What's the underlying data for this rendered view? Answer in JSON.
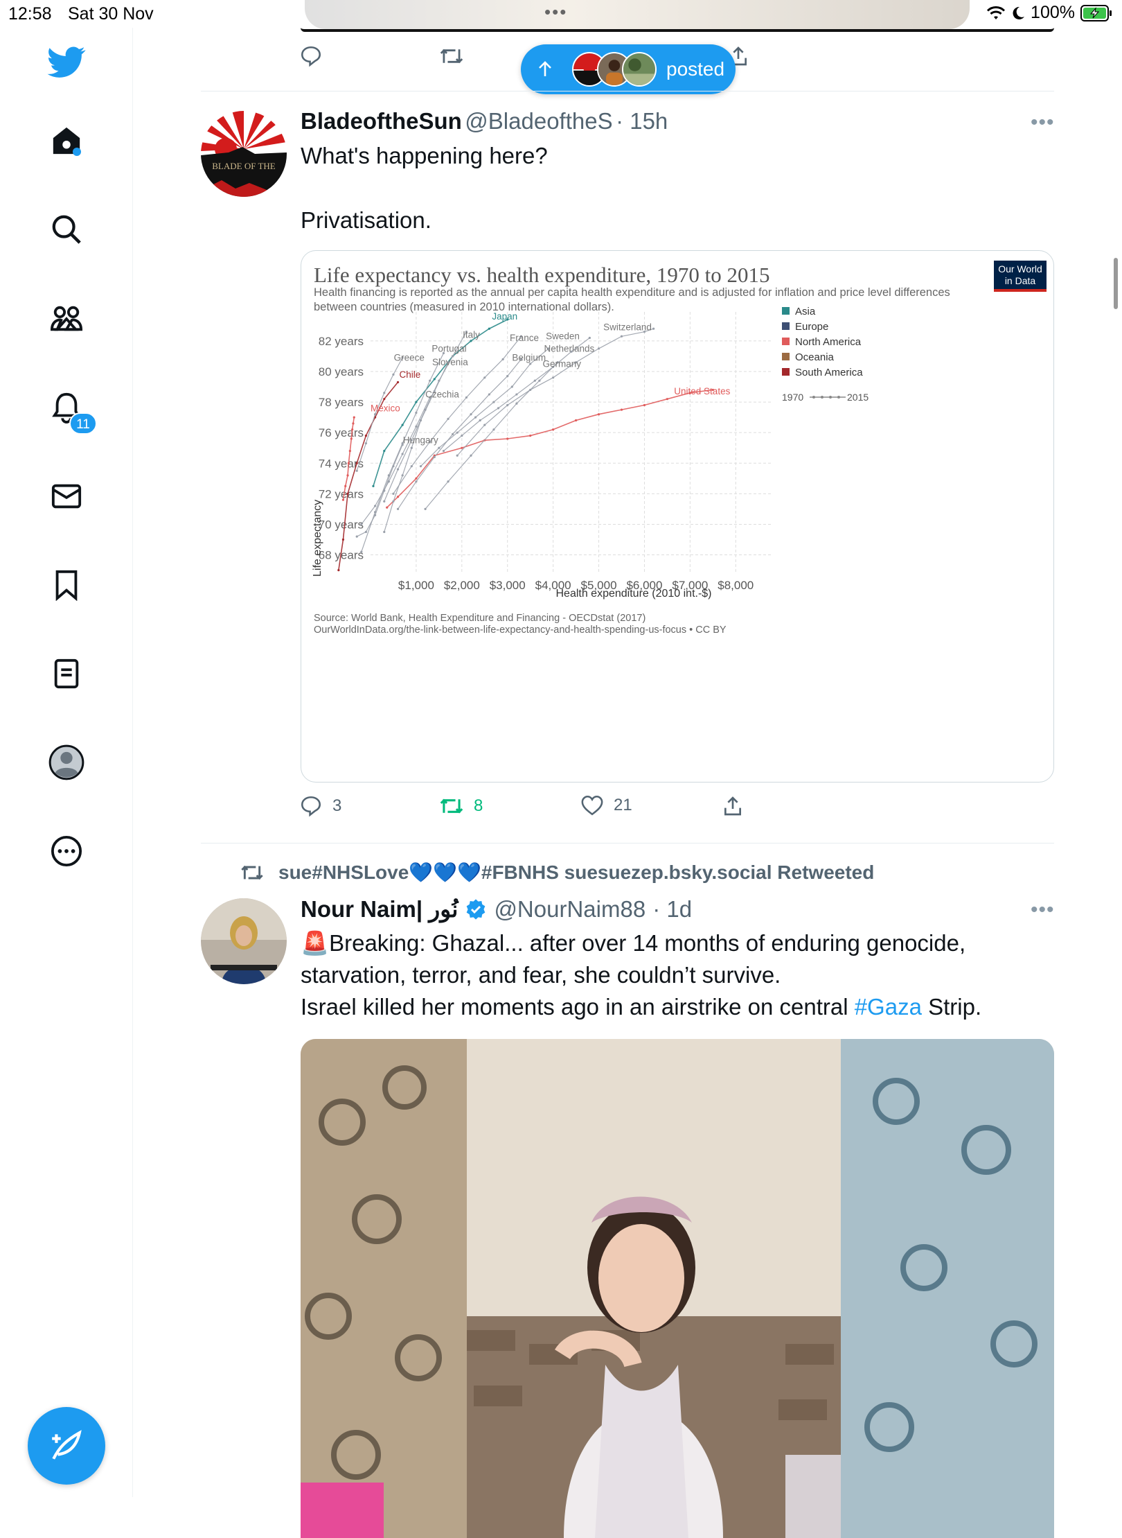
{
  "status": {
    "time": "12:58",
    "date": "Sat 30 Nov",
    "battery": "100%"
  },
  "sidebar": {
    "notification_count": "11"
  },
  "new_posts": {
    "label": "posted"
  },
  "tweet1": {
    "name": "BladeoftheSun",
    "handle": "@BladeoftheS",
    "time": "· 15h",
    "avatar_text": "BLADE OF THE",
    "text_line1": "What's happening here?",
    "text_line2": "Privatisation.",
    "replies": "3",
    "retweets": "8",
    "likes": "21"
  },
  "chart_data": {
    "type": "line",
    "title": "Life expectancy vs. health expenditure, 1970 to 2015",
    "subtitle": "Health financing is reported as the annual per capita health expenditure and is adjusted for inflation and price level differences between countries (measured in 2010 international dollars).",
    "logo": "Our World in Data",
    "xlabel": "Health expenditure (2010 int.-$)",
    "ylabel": "Life expectancy",
    "x_ticks": [
      "$1,000",
      "$2,000",
      "$3,000",
      "$4,000",
      "$5,000",
      "$6,000",
      "$7,000",
      "$8,000"
    ],
    "y_ticks": [
      "82 years",
      "80 years",
      "78 years",
      "76 years",
      "74 years",
      "72 years",
      "70 years",
      "68 years"
    ],
    "xlim": [
      0,
      8800
    ],
    "ylim": [
      66.8,
      83.9
    ],
    "legend": [
      {
        "name": "Asia",
        "color": "#2a8a8a"
      },
      {
        "name": "Europe",
        "color": "#3d4f73"
      },
      {
        "name": "North America",
        "color": "#e05b5b"
      },
      {
        "name": "Oceania",
        "color": "#9c6b42"
      },
      {
        "name": "South America",
        "color": "#a3282b"
      }
    ],
    "legend_range": {
      "start": "1970",
      "end": "2015"
    },
    "country_labels": [
      {
        "name": "Japan",
        "x": 2660,
        "y": 83.4,
        "color": "#2a8a8a"
      },
      {
        "name": "Italy",
        "x": 2020,
        "y": 82.2,
        "color": "#777"
      },
      {
        "name": "Switzerland",
        "x": 5100,
        "y": 82.7,
        "color": "#777"
      },
      {
        "name": "France",
        "x": 3050,
        "y": 82.0,
        "color": "#777"
      },
      {
        "name": "Sweden",
        "x": 3840,
        "y": 82.1,
        "color": "#777"
      },
      {
        "name": "Portugal",
        "x": 1340,
        "y": 81.3,
        "color": "#777"
      },
      {
        "name": "Netherlands",
        "x": 3800,
        "y": 81.3,
        "color": "#777"
      },
      {
        "name": "Greece",
        "x": 510,
        "y": 80.7,
        "color": "#777"
      },
      {
        "name": "Belgium",
        "x": 3100,
        "y": 80.7,
        "color": "#777"
      },
      {
        "name": "Slovenia",
        "x": 1350,
        "y": 80.4,
        "color": "#777"
      },
      {
        "name": "Germany",
        "x": 3770,
        "y": 80.3,
        "color": "#777"
      },
      {
        "name": "Chile",
        "x": 630,
        "y": 79.6,
        "color": "#a3282b"
      },
      {
        "name": "Czechia",
        "x": 1200,
        "y": 78.3,
        "color": "#777"
      },
      {
        "name": "United States",
        "x": 6650,
        "y": 78.5,
        "color": "#e05b5b"
      },
      {
        "name": "Mexico",
        "x": 0,
        "y": 77.4,
        "color": "#e05b5b"
      },
      {
        "name": "Hungary",
        "x": 710,
        "y": 75.3,
        "color": "#777"
      }
    ],
    "series": [
      {
        "name": "United States",
        "region": "North America",
        "x": [
          360,
          600,
          1000,
          1400,
          2000,
          2500,
          3000,
          3500,
          4000,
          4500,
          5000,
          5500,
          6000,
          6500,
          7000,
          7500
        ],
        "y": [
          71.1,
          71.8,
          73.0,
          74.5,
          75.0,
          75.5,
          75.6,
          75.8,
          76.2,
          76.8,
          77.2,
          77.5,
          77.8,
          78.2,
          78.6,
          78.8
        ]
      },
      {
        "name": "Mexico",
        "region": "North America",
        "x": [
          -600,
          -550,
          -500,
          -480,
          -450,
          -420,
          -400,
          -380,
          -360
        ],
        "y": [
          71.6,
          72.5,
          73.2,
          74.0,
          74.8,
          75.6,
          76.2,
          76.6,
          77.0
        ]
      },
      {
        "name": "Japan",
        "region": "Asia",
        "x": [
          60,
          300,
          700,
          1000,
          1400,
          1800,
          2200,
          2600,
          3000
        ],
        "y": [
          72.5,
          74.8,
          76.5,
          78.0,
          79.5,
          81.0,
          82.0,
          82.8,
          83.4
        ]
      },
      {
        "name": "Chile",
        "region": "South America",
        "x": [
          -700,
          -600,
          -500,
          -300,
          -100,
          100,
          300,
          600
        ],
        "y": [
          67.0,
          69.0,
          72.0,
          74.0,
          75.8,
          77.0,
          78.2,
          79.3
        ]
      },
      {
        "name": "Switzerland",
        "region": "Europe",
        "x": [
          1900,
          2500,
          3000,
          3500,
          4000,
          4500,
          5000,
          5500,
          6000,
          6200
        ],
        "y": [
          74.5,
          76.5,
          77.8,
          78.8,
          79.6,
          80.6,
          81.5,
          82.3,
          82.6,
          82.8
        ]
      },
      {
        "name": "Sweden",
        "region": "Europe",
        "x": [
          1600,
          2000,
          2400,
          2800,
          3200,
          3600,
          4000,
          4400,
          4800
        ],
        "y": [
          74.8,
          75.8,
          76.8,
          77.6,
          78.5,
          79.4,
          80.3,
          81.3,
          82.2
        ]
      },
      {
        "name": "France",
        "region": "Europe",
        "x": [
          500,
          900,
          1300,
          1700,
          2100,
          2500,
          2900,
          3300
        ],
        "y": [
          72.0,
          73.8,
          75.4,
          76.9,
          78.3,
          79.6,
          80.8,
          82.3
        ]
      },
      {
        "name": "Italy",
        "region": "Europe",
        "x": [
          300,
          600,
          900,
          1200,
          1500,
          1800,
          2100
        ],
        "y": [
          71.5,
          73.6,
          75.5,
          77.5,
          79.4,
          81.0,
          82.6
        ]
      },
      {
        "name": "Germany",
        "region": "Europe",
        "x": [
          1200,
          1700,
          2200,
          2700,
          3200,
          3700,
          4100
        ],
        "y": [
          71.0,
          72.8,
          74.5,
          76.2,
          77.9,
          79.4,
          80.6
        ]
      },
      {
        "name": "Netherlands",
        "region": "Europe",
        "x": [
          1100,
          1500,
          1900,
          2300,
          2700,
          3100,
          3500,
          3900
        ],
        "y": [
          73.8,
          75.0,
          76.0,
          77.0,
          78.0,
          79.0,
          80.5,
          81.5
        ]
      },
      {
        "name": "Belgium",
        "region": "Europe",
        "x": [
          600,
          1000,
          1400,
          1800,
          2200,
          2600,
          3000,
          3300
        ],
        "y": [
          71.0,
          72.8,
          74.4,
          75.9,
          77.2,
          78.5,
          79.7,
          80.8
        ]
      },
      {
        "name": "Portugal",
        "region": "Europe",
        "x": [
          -200,
          100,
          400,
          700,
          1000,
          1300,
          1600
        ],
        "y": [
          68.2,
          70.8,
          73.2,
          75.3,
          77.3,
          79.4,
          81.2
        ]
      },
      {
        "name": "Slovenia",
        "region": "Europe",
        "x": [
          300,
          500,
          700,
          900,
          1100,
          1400,
          1700
        ],
        "y": [
          69.5,
          71.5,
          73.2,
          75.0,
          76.8,
          78.7,
          80.6
        ]
      },
      {
        "name": "Greece",
        "region": "Europe",
        "x": [
          -300,
          -100,
          100,
          300,
          500,
          700
        ],
        "y": [
          73.5,
          75.3,
          77.2,
          78.6,
          79.8,
          80.9
        ]
      },
      {
        "name": "Czechia",
        "region": "Europe",
        "x": [
          -200,
          100,
          400,
          700,
          1000,
          1300
        ],
        "y": [
          70.0,
          71.2,
          72.8,
          74.6,
          76.4,
          78.3
        ]
      },
      {
        "name": "Hungary",
        "region": "Europe",
        "x": [
          -300,
          -100,
          100,
          300,
          500,
          700
        ],
        "y": [
          69.2,
          69.5,
          70.6,
          72.2,
          73.8,
          75.2
        ]
      }
    ],
    "source_line1": "Source: World Bank, Health Expenditure and Financing - OECDstat (2017)",
    "source_line2": "OurWorldInData.org/the-link-between-life-expectancy-and-health-spending-us-focus • CC BY"
  },
  "tweet2": {
    "retweeted_by": "sue#NHSLove💙💙💙#FBNHS suesuezep.bsky.social Retweeted",
    "name": "Nour Naim| نُور",
    "handle": "@NourNaim88",
    "time": "· 1d",
    "line1": "🚨Breaking: Ghazal... after over 14 months of enduring genocide,",
    "line2": "starvation, terror, and fear, she couldn’t survive.",
    "line3_before": "Israel killed her moments ago in an airstrike on central ",
    "hashtag": "#Gaza",
    "line3_after": " Strip."
  }
}
